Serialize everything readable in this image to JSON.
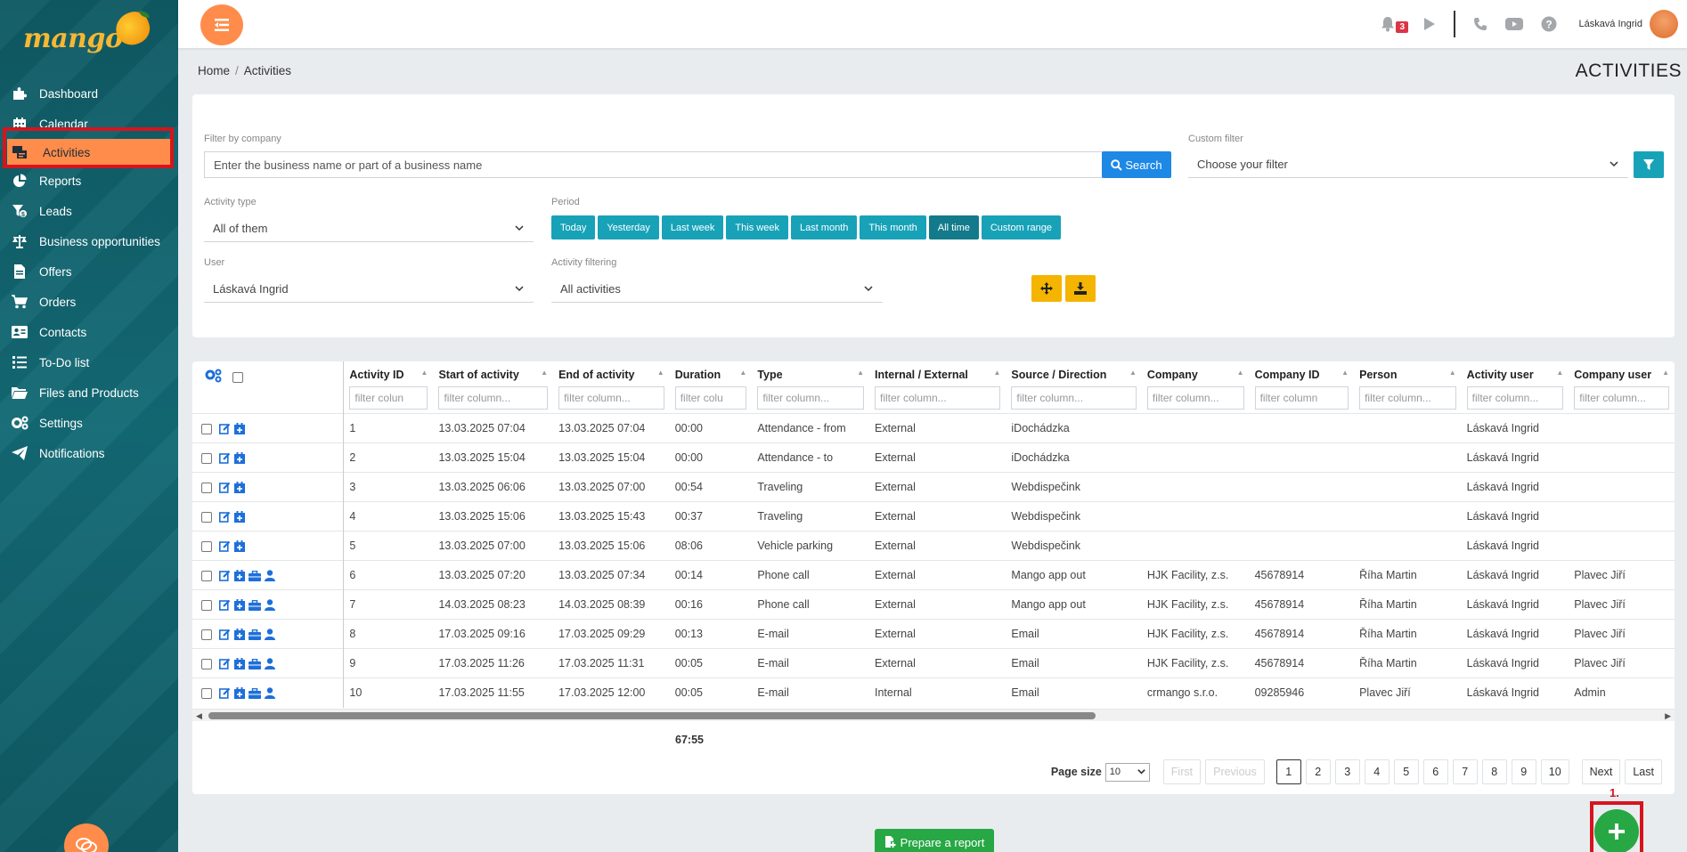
{
  "app": {
    "logo_text": "mango"
  },
  "sidebar": {
    "items": [
      {
        "label": "Dashboard",
        "icon": "puzzle-icon"
      },
      {
        "label": "Calendar",
        "icon": "calendar-icon"
      },
      {
        "label": "Activities",
        "icon": "activities-icon",
        "active": true
      },
      {
        "label": "Reports",
        "icon": "pie-chart-icon"
      },
      {
        "label": "Leads",
        "icon": "leads-icon"
      },
      {
        "label": "Business opportunities",
        "icon": "scales-icon"
      },
      {
        "label": "Offers",
        "icon": "file-icon"
      },
      {
        "label": "Orders",
        "icon": "cart-icon"
      },
      {
        "label": "Contacts",
        "icon": "contact-card-icon"
      },
      {
        "label": "To-Do list",
        "icon": "list-icon"
      },
      {
        "label": "Files and Products",
        "icon": "folder-icon"
      },
      {
        "label": "Settings",
        "icon": "gears-icon"
      },
      {
        "label": "Notifications",
        "icon": "paper-plane-icon"
      }
    ]
  },
  "topbar": {
    "notification_count": "3",
    "user_name": "Láskavá Ingrid"
  },
  "breadcrumb": {
    "home": "Home",
    "current": "Activities"
  },
  "page_title": "ACTIVITIES",
  "filters": {
    "company_label": "Filter by company",
    "company_placeholder": "Enter the business name or part of a business name",
    "search_label": "Search",
    "custom_filter_label": "Custom filter",
    "custom_filter_value": "Choose your filter",
    "activity_type_label": "Activity type",
    "activity_type_value": "All of them",
    "period_label": "Period",
    "period_buttons": [
      "Today",
      "Yesterday",
      "Last week",
      "This week",
      "Last month",
      "This month",
      "All time",
      "Custom range"
    ],
    "period_active": "All time",
    "user_label": "User",
    "user_value": "Láskavá Ingrid",
    "activity_filtering_label": "Activity filtering",
    "activity_filtering_value": "All activities"
  },
  "table": {
    "columns": [
      "Activity ID",
      "Start of activity",
      "End of activity",
      "Duration",
      "Type",
      "Internal / External",
      "Source / Direction",
      "Company",
      "Company ID",
      "Person",
      "Activity user",
      "Company user"
    ],
    "filter_placeholders": [
      "filter colun",
      "filter column...",
      "filter column...",
      "filter colu",
      "filter column...",
      "filter column...",
      "filter column...",
      "filter column...",
      "filter column",
      "filter column...",
      "filter column...",
      "filter column..."
    ],
    "rows": [
      [
        "1",
        "13.03.2025 07:04",
        "13.03.2025 07:04",
        "00:00",
        "Attendance - from",
        "External",
        "iDochádzka",
        "",
        "",
        "",
        "Láskavá Ingrid",
        ""
      ],
      [
        "2",
        "13.03.2025 15:04",
        "13.03.2025 15:04",
        "00:00",
        "Attendance - to",
        "External",
        "iDochádzka",
        "",
        "",
        "",
        "Láskavá Ingrid",
        ""
      ],
      [
        "3",
        "13.03.2025 06:06",
        "13.03.2025 07:00",
        "00:54",
        "Traveling",
        "External",
        "Webdispečink",
        "",
        "",
        "",
        "Láskavá Ingrid",
        ""
      ],
      [
        "4",
        "13.03.2025 15:06",
        "13.03.2025 15:43",
        "00:37",
        "Traveling",
        "External",
        "Webdispečink",
        "",
        "",
        "",
        "Láskavá Ingrid",
        ""
      ],
      [
        "5",
        "13.03.2025 07:00",
        "13.03.2025 15:06",
        "08:06",
        "Vehicle parking",
        "External",
        "Webdispečink",
        "",
        "",
        "",
        "Láskavá Ingrid",
        ""
      ],
      [
        "6",
        "13.03.2025 07:20",
        "13.03.2025 07:34",
        "00:14",
        "Phone call",
        "External",
        "Mango app out",
        "HJK Facility, z.s.",
        "45678914",
        "Říha Martin",
        "Láskavá Ingrid",
        "Plavec Jiří"
      ],
      [
        "7",
        "14.03.2025 08:23",
        "14.03.2025 08:39",
        "00:16",
        "Phone call",
        "External",
        "Mango app out",
        "HJK Facility, z.s.",
        "45678914",
        "Říha Martin",
        "Láskavá Ingrid",
        "Plavec Jiří"
      ],
      [
        "8",
        "17.03.2025 09:16",
        "17.03.2025 09:29",
        "00:13",
        "E-mail",
        "External",
        "Email",
        "HJK Facility, z.s.",
        "45678914",
        "Říha Martin",
        "Láskavá Ingrid",
        "Plavec Jiří"
      ],
      [
        "9",
        "17.03.2025 11:26",
        "17.03.2025 11:31",
        "00:05",
        "E-mail",
        "External",
        "Email",
        "HJK Facility, z.s.",
        "45678914",
        "Říha Martin",
        "Láskavá Ingrid",
        "Plavec Jiří"
      ],
      [
        "10",
        "17.03.2025 11:55",
        "17.03.2025 12:00",
        "00:05",
        "E-mail",
        "Internal",
        "Email",
        "crmango s.r.o.",
        "09285946",
        "Plavec Jiří",
        "Láskavá Ingrid",
        "Admin"
      ]
    ],
    "row_icon_count": [
      2,
      2,
      2,
      2,
      2,
      4,
      4,
      4,
      4,
      4
    ],
    "total_duration": "67:55"
  },
  "pager": {
    "page_size_label": "Page size",
    "page_size_value": "10",
    "first": "First",
    "previous": "Previous",
    "pages": [
      "1",
      "2",
      "3",
      "4",
      "5",
      "6",
      "7",
      "8",
      "9",
      "10"
    ],
    "current": "1",
    "next": "Next",
    "last": "Last"
  },
  "actions": {
    "prepare_report": "Prepare a report",
    "add_annotation": "1."
  },
  "colors": {
    "sidebar": "#0f5a64",
    "accent_orange": "#ff8c4a",
    "teal_button": "#17a2b8",
    "blue_button": "#1e88e5",
    "green_button": "#28a745",
    "yellow_button": "#f5b400",
    "highlight_red": "#d7141d"
  }
}
